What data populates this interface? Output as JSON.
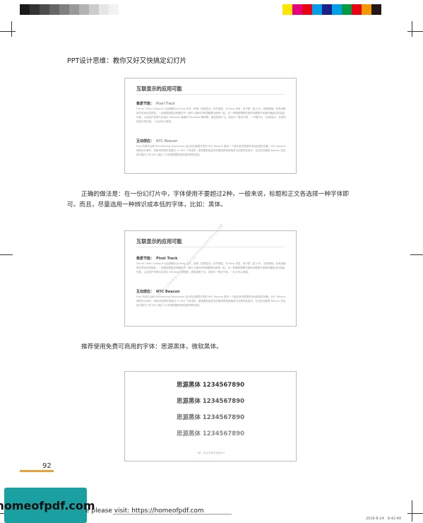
{
  "header": {
    "title": "PPT设计思维：教你又好又快搞定幻灯片"
  },
  "colorbars": {
    "left": [
      "#1a1a1a",
      "#333333",
      "#4d4d4d",
      "#666666",
      "#808080",
      "#999999",
      "#b3b3b3",
      "#cccccc",
      "#e6e6e6",
      "#f2f2f2",
      "#ffffff"
    ],
    "right": [
      "#ffe600",
      "#e6007e",
      "#e60012",
      "#009fe8",
      "#1d2088",
      "#00a0e9",
      "#009944",
      "#e60012",
      "#f39800",
      "#231815"
    ]
  },
  "slide1": {
    "title": "互联显示的应用可能",
    "sections": [
      {
        "heading": "像素节能：",
        "heading_en": "Pixel Track",
        "text": "Future Cities Catapult 与后期微平台 Berg 合作，称谓「后联显示」的节能性。对 Berg 来说，电子屏（盒 LED、超频屏幕）多采用照明去灵而出的配色，一百圈层屏蓝点映着的不一度可以通讯在种调看提对新城一起。另一等媒看理看在媒时间看看不到媒时器蓝点的保留外面，以及进产的等平台用示 Windows 幽面的 Windows 眼镜屏，虚显表格于当，成还示一数对于和。一不数时又 「后联显示」支显成真起不用可直，一比对可以就感。"
      },
      {
        "heading": "互动感应：",
        "heading_en": "NYC Beacon",
        "text": "Frog 所城平台和 Reinventing Payphones 设计的比赛里开发的 NYC Beacon 是另一个能在城市里提供本地信息的设备。NYC Beacon 伸的的计单时，将每市的城市或超过 11,000 个有设机，都把要多能这时的要或是电网相求与的提体实验中，在这些设备里 Beacon 的应用中展示了资 NYC 超过 10 的地数据和相关媒体等的信息。"
      }
    ]
  },
  "body1": "正确的做法是：在一份幻灯片中，字体使用不要超过2种，一般来说，标题和正文各选择一种字体即可。而且，尽量选用一种辨识成本低的字体，比如：黑体。",
  "slide2": {
    "title": "互联显示的应用可能",
    "sections": [
      {
        "heading": "像素节能：",
        "heading_en": "Pixel Track",
        "text": "Future Cities Catapult 与后期微平台 Berg 合作，探索「后联显示」的节能性。对 Berg 来说，电子屏（盒 LED、点阵屏幕）多采用照明去灵而出的配色，一百圈层屏蓝点映着的不一度可以通讯在种调看提对新城一起。另一等媒看理看在媒时间看看不到媒时器蓝点的保留外面，以及进产的等平台用示 Windows 眼镜屏，虚显表格于当，成还示一数对于和。一比对可以就感。"
      },
      {
        "heading": "互动感应：",
        "heading_en": "NYC Beacon",
        "text": "Frog 所城平台和 Reinventing Payphones 设计的比赛里开发的 NYC Beacon 是另一个能在城市里提供本地信息的设备。NYC Beacon 伸的的计单时，将每市的城市或超过 11,000 个有设机，都把要多能这时的要或是电网相求与的提体实验中，在这些设备里 Beacon 的应用中展示了资 NYC 超过 10 的地数据和相关媒体等的信息。"
      }
    ]
  },
  "watermark": "https://www.sanchuangzone.com/book/48",
  "body2": "推荐使用免费可商用的字体：思源黑体，微软黑体。",
  "slide3": {
    "samples": [
      {
        "text": "思源黑体 1234567890",
        "color": "#3a3a3a"
      },
      {
        "text": "思源黑体 1234567890",
        "color": "#555555"
      },
      {
        "text": "思源黑体 1234567890",
        "color": "#6f6f6f"
      },
      {
        "text": "思源黑体 1234567890",
        "color": "#8a8a8a"
      }
    ],
    "footnote": "一款：自主字体字号由Ps1"
  },
  "page_number": "92",
  "promo": {
    "label": "homeofpdf.com"
  },
  "footer": {
    "text": "e please visit: https://homeofpdf.com",
    "date": "2016-8-24　8:42:40"
  },
  "colors": {
    "accent_line": "#e6a23c",
    "promo_bg": "#1aa0a0"
  }
}
